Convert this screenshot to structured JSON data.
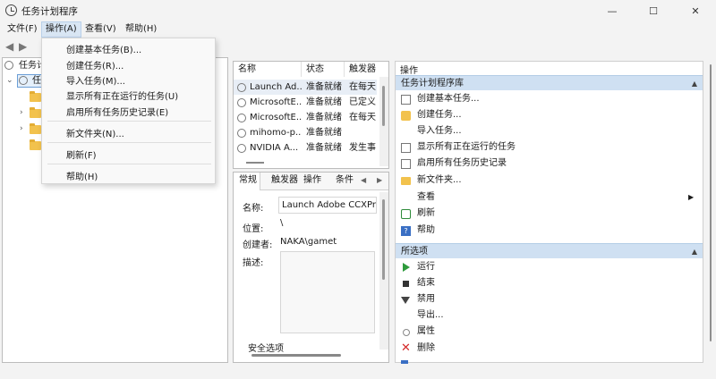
{
  "window": {
    "title": "任务计划程序",
    "minimize_glyph": "—",
    "maximize_glyph": "☐",
    "close_glyph": "✕"
  },
  "menubar": {
    "items": [
      "文件(F)",
      "操作(A)",
      "查看(V)",
      "帮助(H)"
    ],
    "active_index": 1
  },
  "toolbar": {
    "back_glyph": "◀",
    "forward_glyph": "▶"
  },
  "tree": {
    "root_label": "任务计",
    "child_label": "任"
  },
  "dropdown": {
    "items": [
      "创建基本任务(B)...",
      "创建任务(R)...",
      "导入任务(M)...",
      "显示所有正在运行的任务(U)",
      "启用所有任务历史记录(E)",
      "新文件夹(N)...",
      "刷新(F)",
      "帮助(H)"
    ]
  },
  "task_list": {
    "columns": [
      "名称",
      "状态",
      "触发器"
    ],
    "rows": [
      {
        "name": "Launch Ad...",
        "status": "准备就绪",
        "trigger": "在每天"
      },
      {
        "name": "MicrosoftE...",
        "status": "准备就绪",
        "trigger": "已定义"
      },
      {
        "name": "MicrosoftE...",
        "status": "准备就绪",
        "trigger": "在每天"
      },
      {
        "name": "mihomo-p...",
        "status": "准备就绪",
        "trigger": ""
      },
      {
        "name": "NVIDIA A...",
        "status": "准备就绪",
        "trigger": "发生事"
      }
    ]
  },
  "details": {
    "tabs": [
      "常规",
      "触发器",
      "操作",
      "条件"
    ],
    "tab_prev": "◀",
    "tab_next": "▶",
    "fields": {
      "name_label": "名称:",
      "name_value": "Launch Adobe CCXProc",
      "location_label": "位置:",
      "location_value": "\\",
      "author_label": "创建者:",
      "author_value": "NAKA\\gamet",
      "desc_label": "描述:"
    },
    "bottom_text": "安全选项"
  },
  "actions": {
    "title": "操作",
    "section1": {
      "header": "任务计划程序库",
      "items": [
        {
          "label": "创建基本任务...",
          "icon": "create-basic-task-icon"
        },
        {
          "label": "创建任务...",
          "icon": "create-task-icon"
        },
        {
          "label": "导入任务...",
          "icon": ""
        },
        {
          "label": "显示所有正在运行的任务",
          "icon": "running-tasks-icon"
        },
        {
          "label": "启用所有任务历史记录",
          "icon": "history-icon"
        },
        {
          "label": "新文件夹...",
          "icon": "folder-icon"
        },
        {
          "label": "查看",
          "icon": ""
        },
        {
          "label": "刷新",
          "icon": "refresh-icon"
        },
        {
          "label": "帮助",
          "icon": "help-icon"
        }
      ]
    },
    "section2": {
      "header": "所选项",
      "items": [
        {
          "label": "运行",
          "icon": "run-icon"
        },
        {
          "label": "结束",
          "icon": "end-icon"
        },
        {
          "label": "禁用",
          "icon": "disable-icon"
        },
        {
          "label": "导出...",
          "icon": ""
        },
        {
          "label": "属性",
          "icon": "properties-icon"
        },
        {
          "label": "删除",
          "icon": "delete-icon"
        }
      ]
    },
    "collapse_glyph": "▲",
    "submenu_glyph": "▶"
  }
}
